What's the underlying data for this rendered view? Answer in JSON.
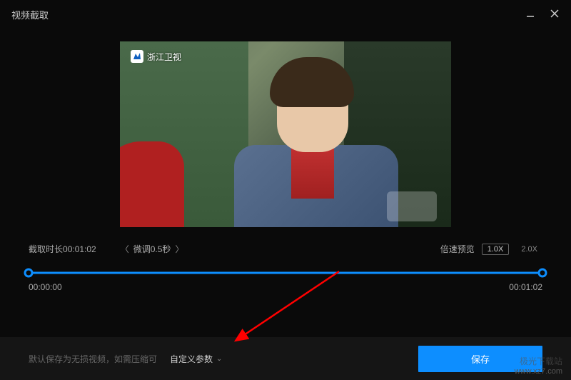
{
  "titlebar": {
    "title": "视频截取"
  },
  "channel": {
    "name": "浙江卫视"
  },
  "trim": {
    "duration_label": "截取时长",
    "duration_value": "00:01:02",
    "fine_tune_label": "微调0.5秒",
    "speed_label": "倍速预览",
    "speed_option_1": "1.0X",
    "speed_option_2": "2.0X",
    "start_time": "00:00:00",
    "end_time": "00:01:02"
  },
  "bottom": {
    "description": "默认保存为无损视频，如需压缩可",
    "custom_params_label": "自定义参数",
    "save_label": "保存"
  },
  "watermark": {
    "line1": "极光下载站",
    "line2": "www.xz7.com"
  }
}
